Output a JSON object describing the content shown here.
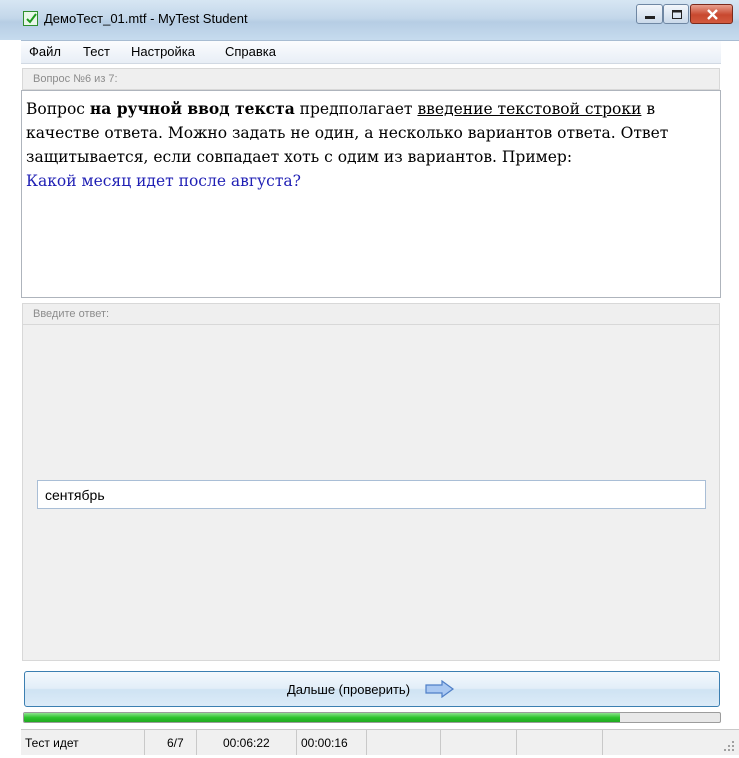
{
  "window": {
    "title": "ДемоТест_01.mtf - MyTest Student"
  },
  "menu": [
    "Файл",
    "Тест",
    "Настройка",
    "Справка"
  ],
  "question_panel": {
    "header": "Вопрос №6 из 7:",
    "text": {
      "part1": "Вопрос ",
      "bold": "на ручной ввод текста",
      "part2": " предполагает ",
      "underlined": "введение текстовой строки",
      "part3": " в качестве ответа. Можно задать не один, а несколько вариантов ответа. Ответ защитывается, если совпадает хоть с одим из вариантов. Пример:",
      "example": "Какой месяц идет после августа?"
    }
  },
  "answer_panel": {
    "header": "Введите ответ:",
    "value": "сентябрь"
  },
  "next_button": {
    "label": "Дальше (проверить)"
  },
  "progress": {
    "fraction": 0.857
  },
  "status": {
    "state": "Тест идет",
    "count": "6/7",
    "elapsed": "00:06:22",
    "question_time": "00:00:16"
  },
  "colors": {
    "example_text": "#1f1fb4",
    "progress": "#2ec42e",
    "accent_border": "#3c7fb1"
  }
}
